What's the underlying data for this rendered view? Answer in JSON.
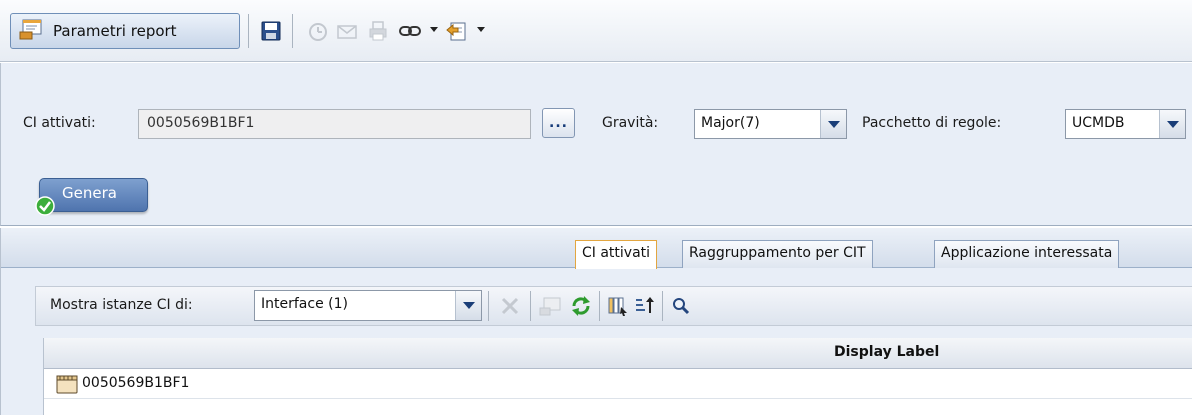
{
  "toolbar": {
    "report_params_label": "Parametri report",
    "icons": [
      "report-params-icon",
      "save-icon",
      "schedule-icon",
      "email-icon",
      "print-icon",
      "link-icon",
      "export-icon"
    ]
  },
  "params": {
    "ci_label": "CI attivati:",
    "ci_value": "0050569B1BF1",
    "dots_label": "...",
    "severity_label": "Gravità:",
    "severity_value": "Major(7)",
    "ruleset_label": "Pacchetto di regole:",
    "ruleset_value": "UCMDB",
    "generate_label": "Genera"
  },
  "tabs": [
    {
      "label": "CI attivati",
      "active": true
    },
    {
      "label": "Raggruppamento per CIT",
      "active": false
    },
    {
      "label": "Applicazione interessata",
      "active": false
    }
  ],
  "filter": {
    "label": "Mostra istanze CI di:",
    "value": "Interface (1)"
  },
  "grid": {
    "columns": [
      "Display Label"
    ],
    "rows": [
      {
        "label": "0050569B1BF1"
      }
    ]
  },
  "colors": {
    "panel_bg": "#e8eef7",
    "accent": "#1a3e78",
    "active_tab_border": "#e3a640",
    "ok_green": "#3cae3c"
  }
}
